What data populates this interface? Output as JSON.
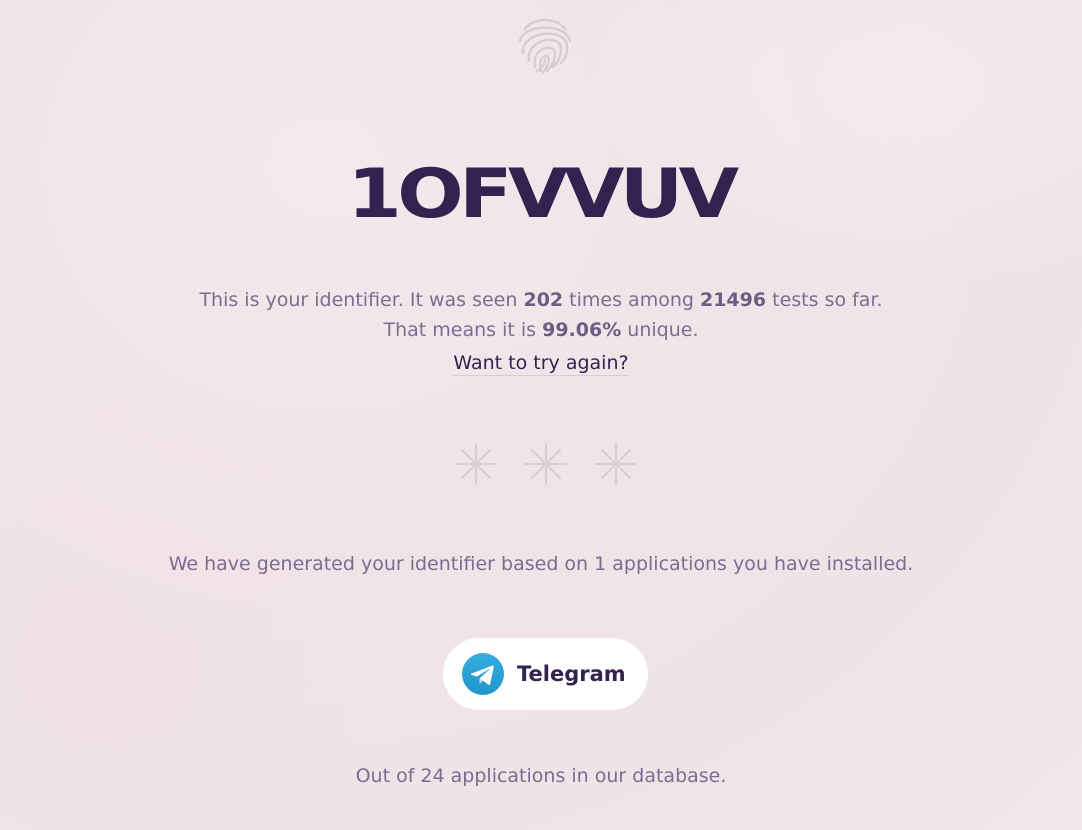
{
  "identifier": "1OFVVUV",
  "summary": {
    "prefix": "This is your identifier. It was seen ",
    "seen_count": "202",
    "middle": " times among ",
    "tests_count": "21496",
    "suffix": " tests so far."
  },
  "uniqueness": {
    "prefix": "That means it is ",
    "percent": "99.06%",
    "suffix": " unique."
  },
  "retry_link": "Want to try again?",
  "generated_note": "We have generated your identifier based on 1 applications you have installed.",
  "apps": [
    {
      "name": "Telegram",
      "icon": "telegram-icon"
    }
  ],
  "database_note": "Out of 24 applications in our database.",
  "colors": {
    "accent": "#33224f",
    "text": "#7d6c8f",
    "background": "#f1e4e8",
    "telegram": "#2ba3dd"
  }
}
